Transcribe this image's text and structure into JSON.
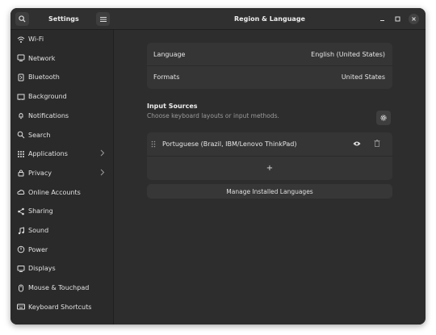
{
  "sidebar": {
    "title": "Settings",
    "items": [
      {
        "label": "Wi-Fi",
        "icon": "wifi-icon"
      },
      {
        "label": "Network",
        "icon": "network-icon"
      },
      {
        "label": "Bluetooth",
        "icon": "bluetooth-icon"
      },
      {
        "label": "Background",
        "icon": "background-icon"
      },
      {
        "label": "Notifications",
        "icon": "bell-icon"
      },
      {
        "label": "Search",
        "icon": "search-icon"
      },
      {
        "label": "Applications",
        "icon": "apps-grid-icon"
      },
      {
        "label": "Privacy",
        "icon": "lock-icon"
      },
      {
        "label": "Online Accounts",
        "icon": "cloud-icon"
      },
      {
        "label": "Sharing",
        "icon": "share-icon"
      },
      {
        "label": "Sound",
        "icon": "music-note-icon"
      },
      {
        "label": "Power",
        "icon": "power-icon"
      },
      {
        "label": "Displays",
        "icon": "display-icon"
      },
      {
        "label": "Mouse & Touchpad",
        "icon": "mouse-icon"
      },
      {
        "label": "Keyboard Shortcuts",
        "icon": "keyboard-icon"
      }
    ]
  },
  "header": {
    "title": "Region & Language"
  },
  "language_card": {
    "language_label": "Language",
    "language_value": "English (United States)",
    "formats_label": "Formats",
    "formats_value": "United States"
  },
  "input_sources": {
    "title": "Input Sources",
    "subtitle": "Choose keyboard layouts or input methods.",
    "sources": [
      {
        "name": "Portuguese (Brazil, IBM/Lenovo ThinkPad)"
      }
    ],
    "add_label": "+"
  },
  "manage_button": "Manage Installed Languages",
  "colors": {
    "window_bg": "#2d2d2d",
    "sidebar_bg": "#2a2a2a",
    "card_bg": "#353535",
    "text": "#e6e6e6"
  }
}
